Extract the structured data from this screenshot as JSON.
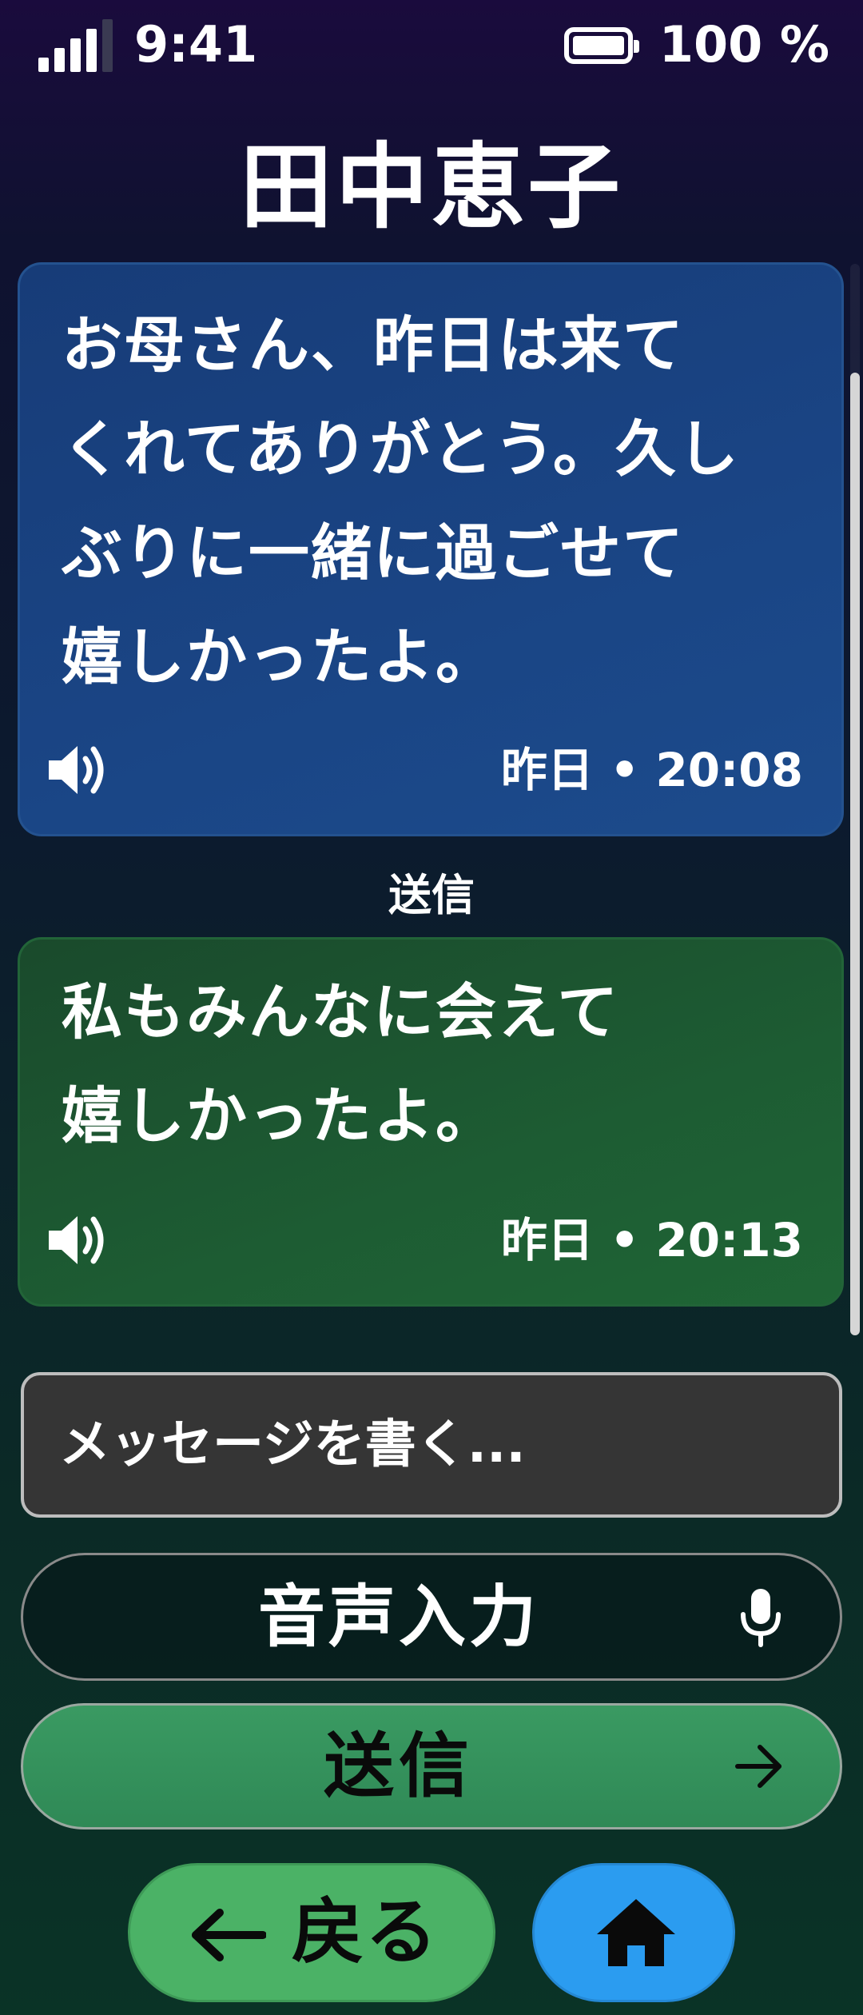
{
  "status_bar": {
    "time": "9:41",
    "battery_percent": "100 %",
    "signal_bars_filled": 4,
    "signal_bars_total": 5
  },
  "header": {
    "title": "田中恵子"
  },
  "conversation": {
    "received": {
      "text": "お母さん、昨日は来てくれてありがとう。久しぶりに一緒に過ごせて嬉しかったよ。",
      "timestamp": "昨日 • 20:08",
      "icon": "speaker-icon",
      "color": "#1a4585"
    },
    "sent_label": "送信",
    "sent": {
      "text": "私もみんなに会えて嬉しかったよ。",
      "timestamp": "昨日 • 20:13",
      "icon": "speaker-icon",
      "color": "#1d5c33"
    }
  },
  "composer": {
    "placeholder": "メッセージを書く...",
    "value": ""
  },
  "voice_button": {
    "label": "音声入力",
    "icon": "microphone-icon"
  },
  "send_button": {
    "label": "送信",
    "icon": "arrow-right-icon",
    "color": "#2f8956"
  },
  "nav": {
    "back_label": "戻る",
    "back_icon": "arrow-left-icon",
    "back_color": "#4bb266",
    "home_icon": "home-icon",
    "home_color": "#2b9cf0"
  }
}
